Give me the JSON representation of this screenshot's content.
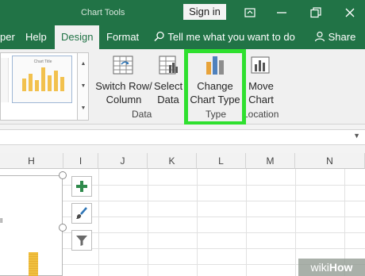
{
  "titlebar": {
    "context_label": "Chart Tools",
    "signin_label": "Sign in",
    "icons": [
      "ribbon-display-icon",
      "minimize-icon",
      "restore-icon",
      "close-icon"
    ]
  },
  "tabs": {
    "items": [
      {
        "label": "per",
        "active": false
      },
      {
        "label": "Help",
        "active": false
      },
      {
        "label": "Design",
        "active": true
      },
      {
        "label": "Format",
        "active": false
      }
    ],
    "tell_me": "Tell me what you want to do",
    "share": "Share"
  },
  "ribbon": {
    "chart_styles": {
      "thumbnail_title": "Chart Title"
    },
    "data_group": {
      "label": "Data",
      "switch_row_column": [
        "Switch Row/",
        "Column"
      ],
      "select_data": [
        "Select",
        "Data"
      ]
    },
    "type_group": {
      "label": "Type",
      "change_chart_type": [
        "Change",
        "Chart Type"
      ]
    },
    "location_group": {
      "label": "Location",
      "move_chart": [
        "Move",
        "Chart"
      ]
    }
  },
  "sheet": {
    "column_headers": [
      "H",
      "I",
      "J",
      "K",
      "L",
      "M",
      "N"
    ],
    "chart_tick": "ll"
  },
  "chart_side_buttons": [
    "plus-icon",
    "brush-icon",
    "filter-icon"
  ],
  "watermark": {
    "prefix": "wiki",
    "suffix": "How"
  },
  "colors": {
    "accent": "#217346",
    "highlight": "#2fe02f",
    "bar": "#f0c040"
  }
}
